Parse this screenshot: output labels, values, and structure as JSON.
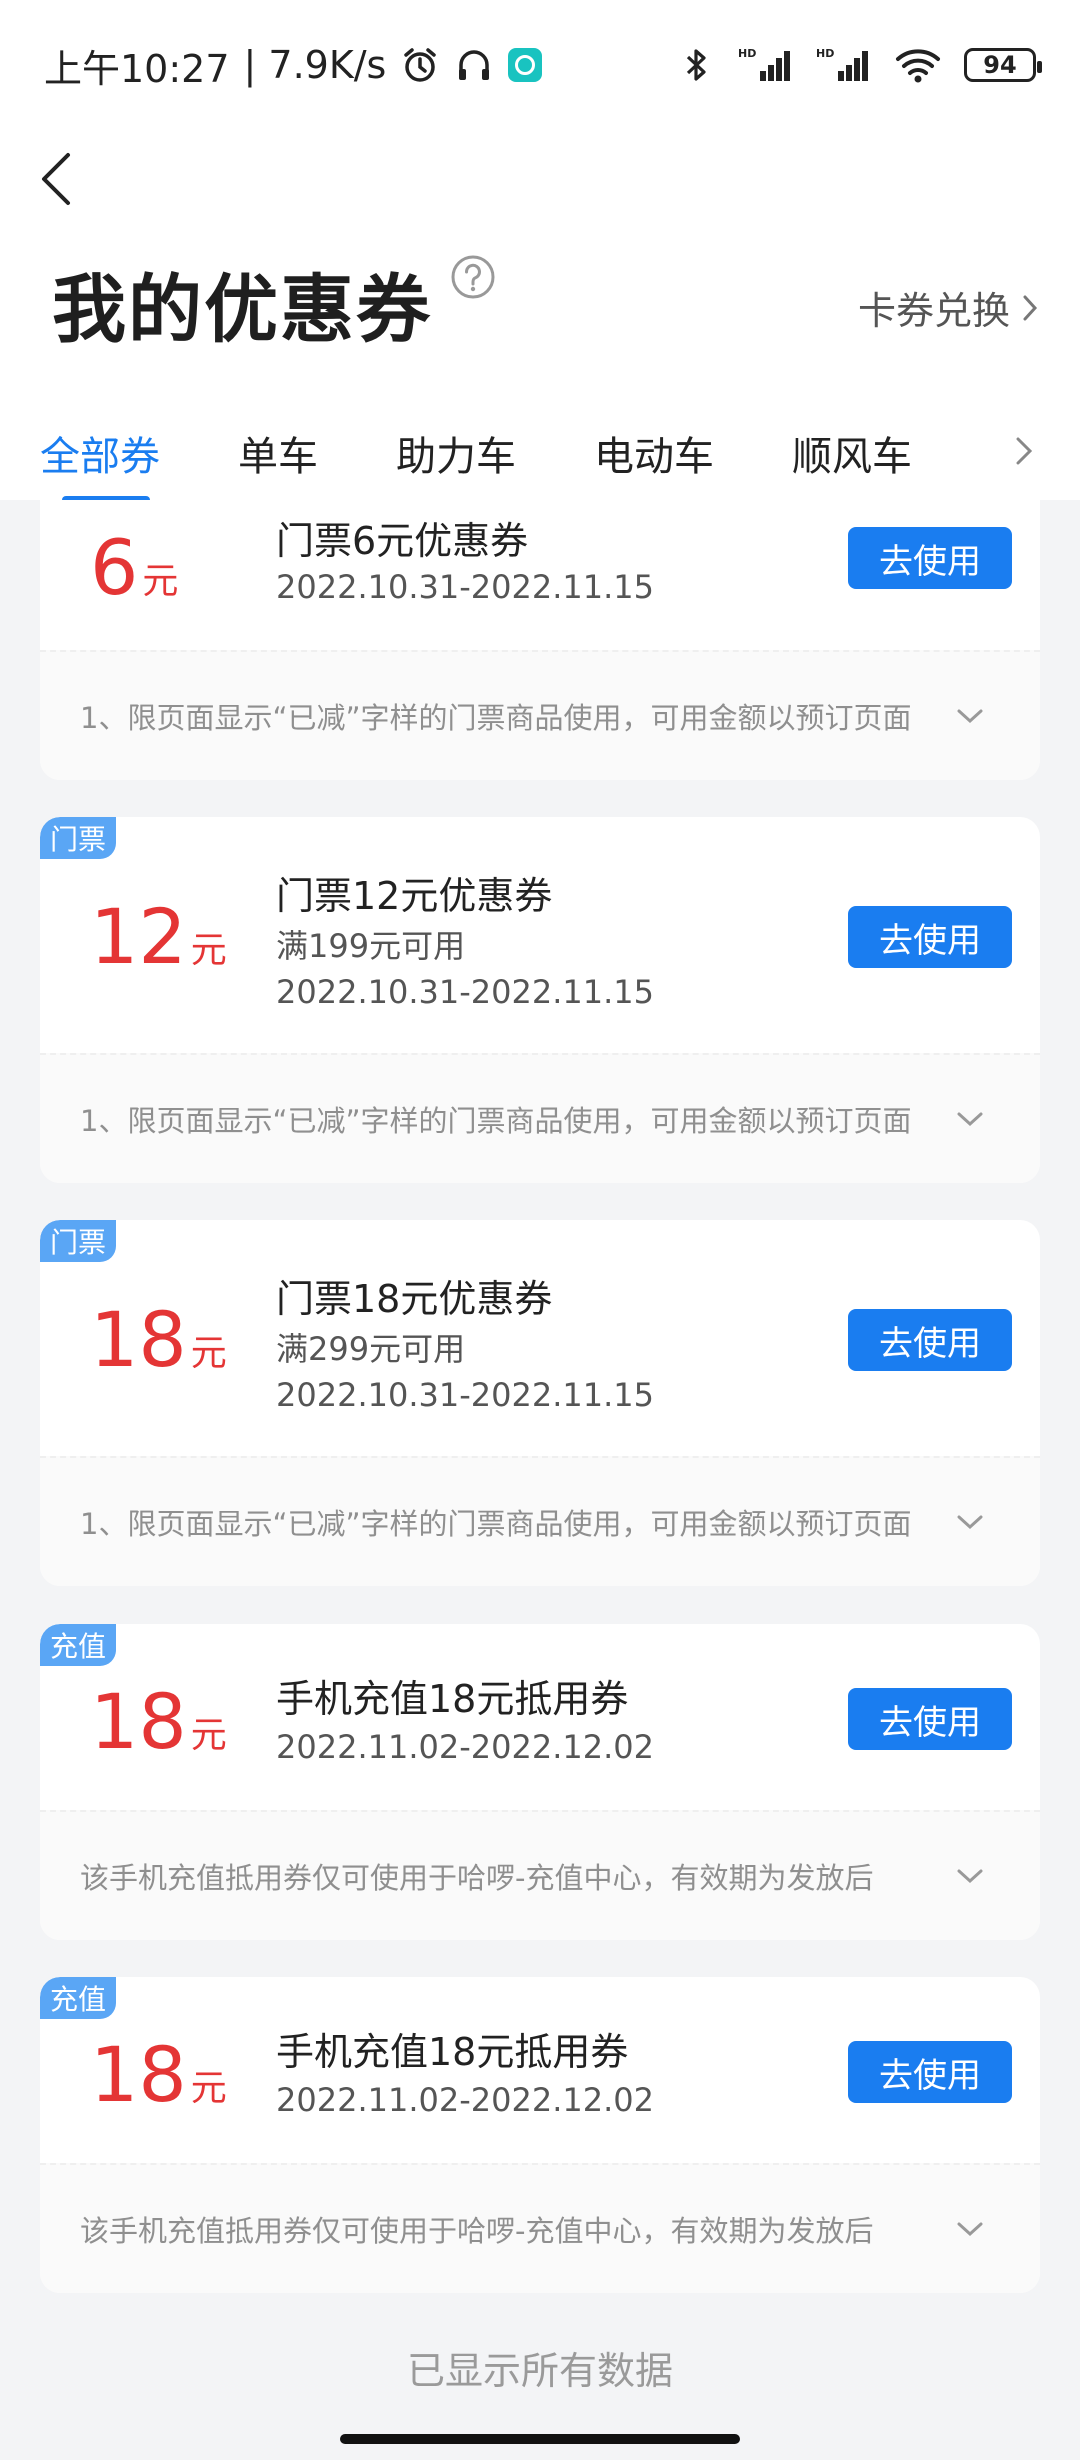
{
  "status": {
    "time": "上午10:27",
    "speed": "| 7.9K/s",
    "battery": "94"
  },
  "header": {
    "title": "我的优惠券",
    "exchange": "卡券兑换"
  },
  "tabs": [
    "全部券",
    "单车",
    "助力车",
    "电动车",
    "顺风车"
  ],
  "coupons": [
    {
      "amount": "6",
      "unit": "元",
      "name": "门票6元优惠券",
      "date": "2022.10.31-2022.11.15",
      "button": "去使用",
      "note": "1、限页面显示“已减”字样的门票商品使用，可用金额以预订页面"
    },
    {
      "tag": "门票",
      "amount": "12",
      "unit": "元",
      "name": "门票12元优惠券",
      "condition": "满199元可用",
      "date": "2022.10.31-2022.11.15",
      "button": "去使用",
      "note": "1、限页面显示“已减”字样的门票商品使用，可用金额以预订页面"
    },
    {
      "tag": "门票",
      "amount": "18",
      "unit": "元",
      "name": "门票18元优惠券",
      "condition": "满299元可用",
      "date": "2022.10.31-2022.11.15",
      "button": "去使用",
      "note": "1、限页面显示“已减”字样的门票商品使用，可用金额以预订页面"
    },
    {
      "tag": "充值",
      "amount": "18",
      "unit": "元",
      "name": "手机充值18元抵用券",
      "date": "2022.11.02-2022.12.02",
      "button": "去使用",
      "note": "该手机充值抵用券仅可使用于哈啰-充值中心，有效期为发放后"
    },
    {
      "tag": "充值",
      "amount": "18",
      "unit": "元",
      "name": "手机充值18元抵用券",
      "date": "2022.11.02-2022.12.02",
      "button": "去使用",
      "note": "该手机充值抵用券仅可使用于哈啰-充值中心，有效期为发放后"
    }
  ],
  "footer": {
    "end_text": "已显示所有数据"
  },
  "colors": {
    "accent": "#1a7df0",
    "amount": "#e43535",
    "tag": "#5aa6f5"
  }
}
